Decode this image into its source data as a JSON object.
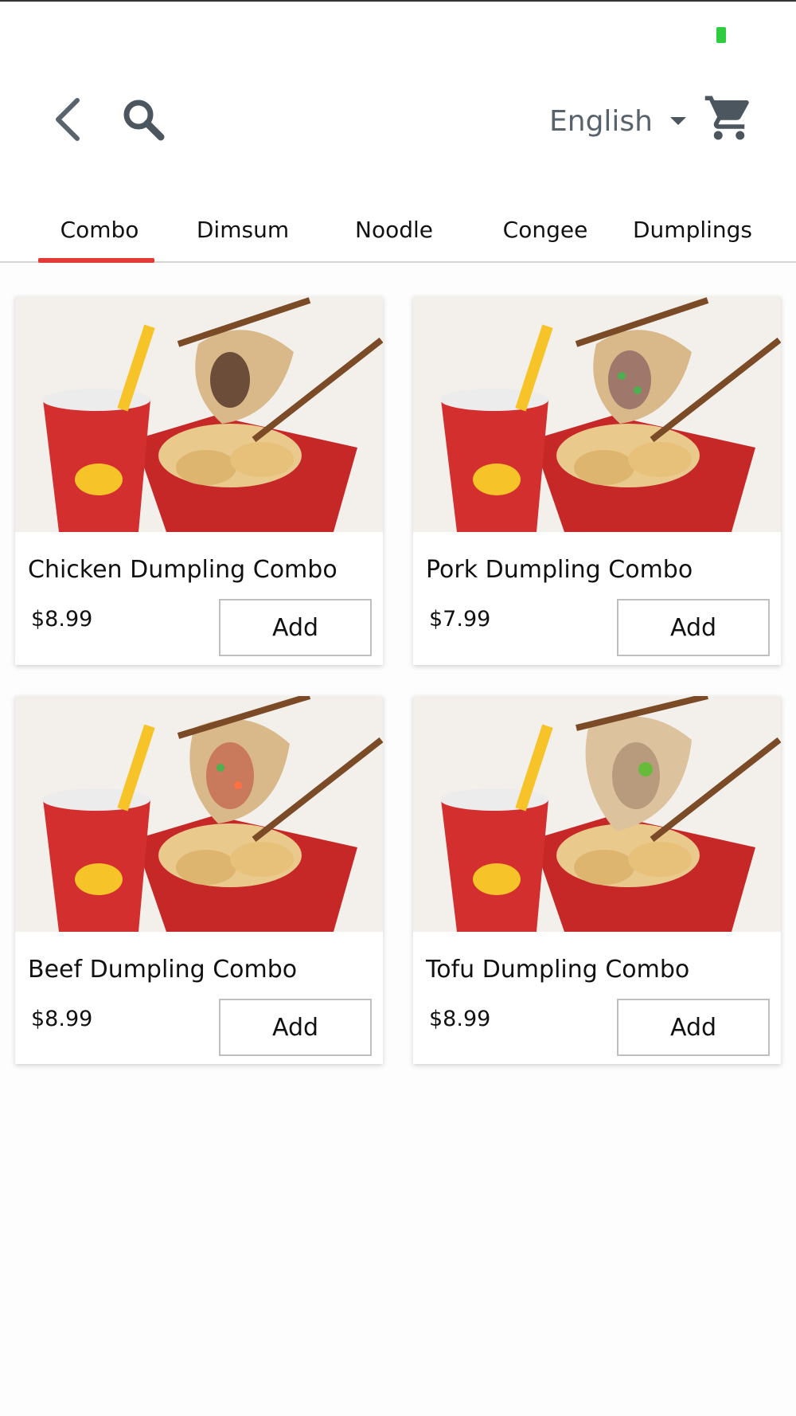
{
  "header": {
    "language": "English",
    "icons": [
      "back-icon",
      "search-icon",
      "cart-icon"
    ]
  },
  "tabs": [
    {
      "label": "Combo",
      "active": true
    },
    {
      "label": "Dimsum",
      "active": false
    },
    {
      "label": "Noodle",
      "active": false
    },
    {
      "label": "Congee",
      "active": false
    },
    {
      "label": "Dumplings",
      "active": false
    }
  ],
  "products": [
    {
      "name": "Chicken Dumpling Combo",
      "price": "$8.99",
      "add_label": "Add"
    },
    {
      "name": "Pork Dumpling Combo",
      "price": "$7.99",
      "add_label": "Add"
    },
    {
      "name": "Beef Dumpling Combo",
      "price": "$8.99",
      "add_label": "Add"
    },
    {
      "name": "Tofu Dumpling Combo",
      "price": "$8.99",
      "add_label": "Add"
    }
  ],
  "colors": {
    "accent": "#e53935",
    "cup": "#d32f2f",
    "straw": "#f6c429",
    "icon": "#4b565f"
  }
}
